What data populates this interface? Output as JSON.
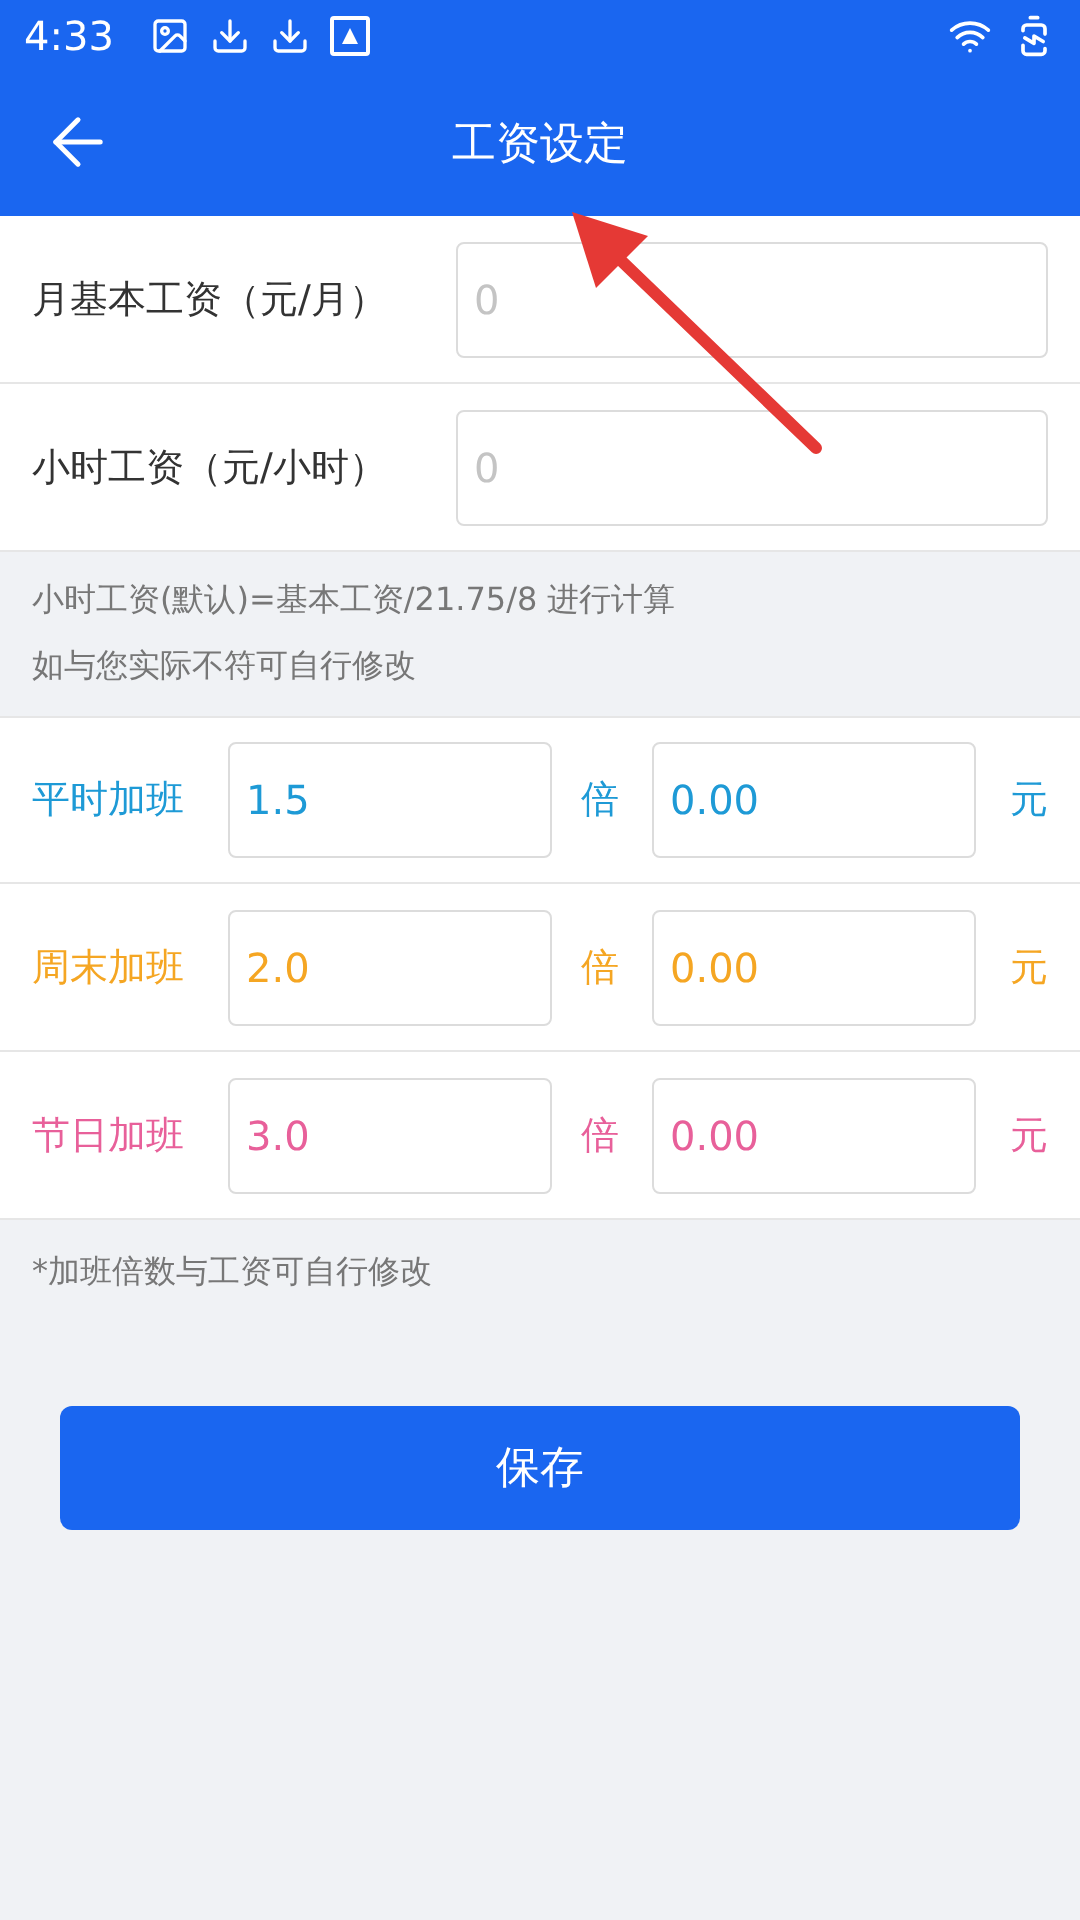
{
  "status_bar": {
    "time": "4:33"
  },
  "header": {
    "title": "工资设定"
  },
  "salary_fields": [
    {
      "label": "月基本工资（元/月）",
      "placeholder": "0"
    },
    {
      "label": "小时工资（元/小时）",
      "placeholder": "0"
    }
  ],
  "note_lines": [
    "小时工资(默认)=基本工资/21.75/8 进行计算",
    "如与您实际不符可自行修改"
  ],
  "overtime_rows": [
    {
      "label": "平时加班",
      "multiplier": "1.5",
      "multiplier_unit": "倍",
      "amount": "0.00",
      "amount_unit": "元",
      "color": "#1e9ad6"
    },
    {
      "label": "周末加班",
      "multiplier": "2.0",
      "multiplier_unit": "倍",
      "amount": "0.00",
      "amount_unit": "元",
      "color": "#f5a623"
    },
    {
      "label": "节日加班",
      "multiplier": "3.0",
      "multiplier_unit": "倍",
      "amount": "0.00",
      "amount_unit": "元",
      "color": "#e8609a"
    }
  ],
  "footnote": "*加班倍数与工资可自行修改",
  "save_button": "保存"
}
